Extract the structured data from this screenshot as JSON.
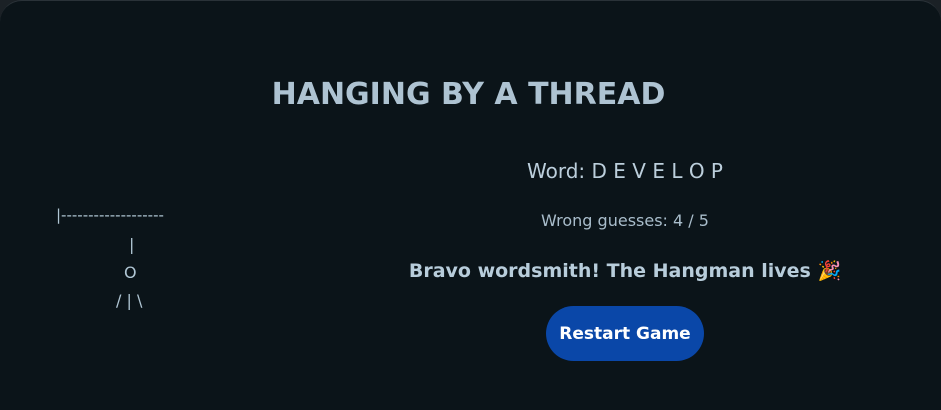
{
  "game": {
    "title": "HANGING BY A THREAD",
    "word_label": "Word:",
    "word_letters": "D E V E L O P",
    "wrong_guesses_label": "Wrong guesses:",
    "wrong_guesses_value": "4 / 5",
    "message": "Bravo wordsmith! The Hangman lives 🎉",
    "restart_label": "Restart Game"
  },
  "gallows": {
    "beam": "|-------------------",
    "rope": "|",
    "head": "O",
    "body": "/ | \\"
  },
  "colors": {
    "background": "#0b1419",
    "title": "#aec3d2",
    "button": "#0a47a8",
    "button_text": "#ffffff"
  }
}
